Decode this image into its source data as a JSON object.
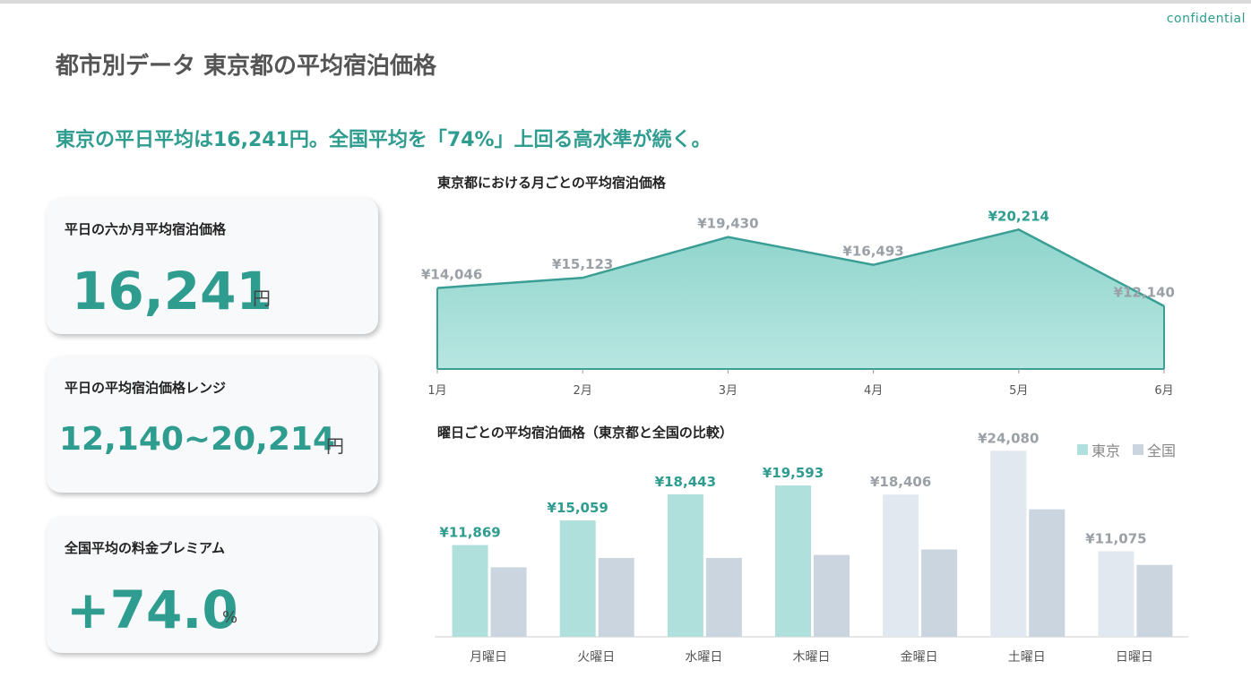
{
  "header": {
    "confidential": "confidential",
    "title": "都市別データ 東京都の平均宿泊価格",
    "headline": "東京の平日平均は16,241円。全国平均を「74%」上回る高水準が続く。"
  },
  "kpis": [
    {
      "label": "平日の六か月平均宿泊価格",
      "value": "16,241",
      "unit": "円"
    },
    {
      "label": "平日の平均宿泊価格レンジ",
      "value": "12,140~20,214",
      "unit": "円"
    },
    {
      "label": "全国平均の料金プレミアム",
      "value": "+74.0",
      "unit": "%"
    }
  ],
  "colors": {
    "accent": "#2f9c90",
    "tokyo_bar": "#b0e0dc",
    "national_bar": "#cbd5e0",
    "muted_tokyo_bar": "#e2e8f0"
  },
  "chart_data": [
    {
      "type": "area",
      "title": "東京都における月ごとの平均宿泊価格",
      "categories": [
        "1月",
        "2月",
        "3月",
        "4月",
        "5月",
        "6月"
      ],
      "values": [
        14046,
        15123,
        19430,
        16493,
        20214,
        12140
      ],
      "labels": [
        "¥14,046",
        "¥15,123",
        "¥19,430",
        "¥16,493",
        "¥20,214",
        "¥12,140"
      ],
      "highlight_index": 4,
      "ylim": [
        5500,
        21000
      ]
    },
    {
      "type": "bar",
      "title": "曜日ごとの平均宿泊価格（東京都と全国の比較）",
      "categories": [
        "月曜日",
        "火曜日",
        "水曜日",
        "木曜日",
        "金曜日",
        "土曜日",
        "日曜日"
      ],
      "series": [
        {
          "name": "東京",
          "values": [
            11869,
            15059,
            18443,
            19593,
            18406,
            24080,
            11075
          ],
          "labels": [
            "¥11,869",
            "¥15,059",
            "¥18,443",
            "¥19,593",
            "¥18,406",
            "¥24,080",
            "¥11,075"
          ]
        },
        {
          "name": "全国",
          "values": [
            9000,
            10200,
            10200,
            10600,
            11300,
            16500,
            9300
          ]
        }
      ],
      "weekday_count": 4,
      "legend": "top-right",
      "ylim": [
        0,
        25500
      ]
    }
  ]
}
